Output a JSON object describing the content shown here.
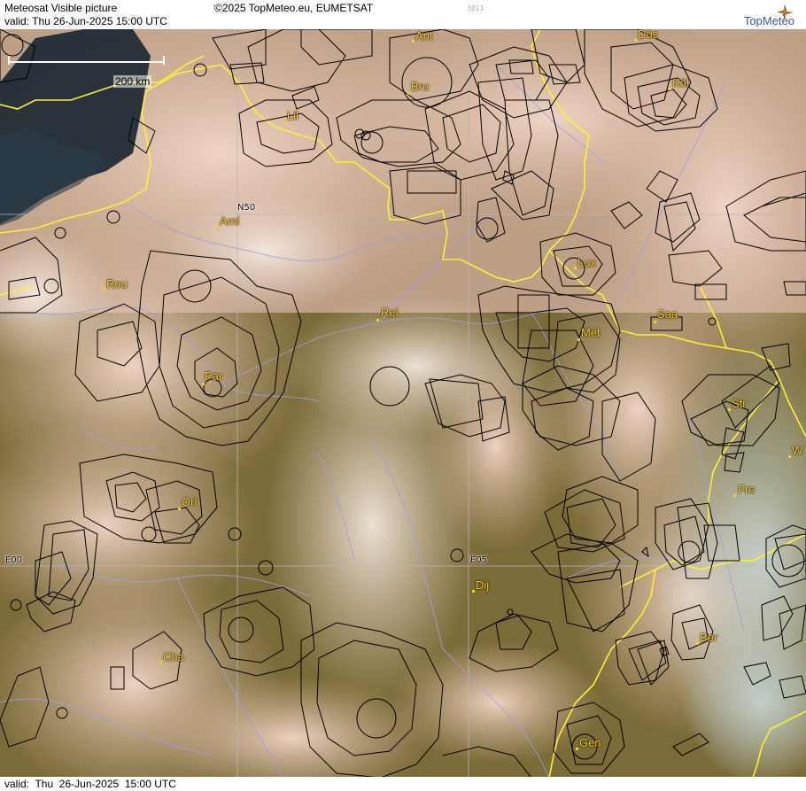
{
  "header": {
    "title": "Meteosat Visible picture",
    "valid": "valid:  Thu  26-Jun-2025  15:00 UTC",
    "copyright": "©2025 TopMeteo.eu, EUMETSAT",
    "code": "3011",
    "logo_text": "TopMeteo"
  },
  "footer": {
    "valid": "valid:  Thu  26-Jun-2025  15:00 UTC"
  },
  "scale": {
    "label": "200 km"
  },
  "grid_labels": {
    "n50": "N50",
    "e00": "E00",
    "e05": "E05"
  },
  "cities": [
    {
      "name": "Ant"
    },
    {
      "name": "Düs"
    },
    {
      "name": "Bru"
    },
    {
      "name": "Köl"
    },
    {
      "name": "Lil"
    },
    {
      "name": "Ami"
    },
    {
      "name": "Rou"
    },
    {
      "name": "Lux"
    },
    {
      "name": "Rei"
    },
    {
      "name": "Saa"
    },
    {
      "name": "Met"
    },
    {
      "name": "Par"
    },
    {
      "name": "Str"
    },
    {
      "name": "W"
    },
    {
      "name": "Fre"
    },
    {
      "name": "Orl"
    },
    {
      "name": "Dij"
    },
    {
      "name": "Ber"
    },
    {
      "name": "Cha"
    },
    {
      "name": "Gen"
    }
  ],
  "colors": {
    "border": "#ffee33",
    "river": "#9aa0e8",
    "airspace": "#000000",
    "city": "#ffcc22",
    "grid": "#b0b0b0"
  }
}
